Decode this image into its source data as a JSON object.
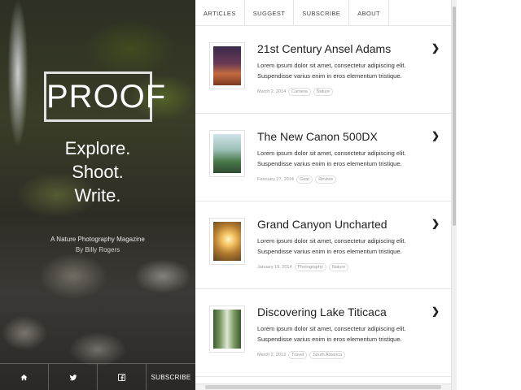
{
  "hero": {
    "logo": "PROOF",
    "tagline": [
      "Explore.",
      "Shoot.",
      "Write."
    ],
    "subtitle": "A Nature Photography Magazine",
    "byline": "By Billy Rogers"
  },
  "footer": {
    "icons": [
      "home-icon",
      "twitter-icon",
      "facebook-icon"
    ],
    "subscribe_label": "SUBSCRIBE"
  },
  "nav": [
    "ARTICLES",
    "SUGGEST",
    "SUBSCRIBE",
    "ABOUT"
  ],
  "chevron": "❯",
  "articles": [
    {
      "title": "21st Century Ansel Adams",
      "excerpt": "Lorem ipsum dolor sit amet, consectetur adipiscing elit. Suspendisse varius enim in eros elementum tristique.",
      "date": "March 2, 2014",
      "tags": [
        "Camera",
        "Nature"
      ]
    },
    {
      "title": "The New Canon 500DX",
      "excerpt": "Lorem ipsum dolor sit amet, consectetur adipiscing elit. Suspendisse varius enim in eros elementum tristique.",
      "date": "February 27, 2014",
      "tags": [
        "Gear",
        "Review"
      ]
    },
    {
      "title": "Grand Canyon Uncharted",
      "excerpt": "Lorem ipsum dolor sit amet, consectetur adipiscing elit. Suspendisse varius enim in eros elementum tristique.",
      "date": "January 19, 2014",
      "tags": [
        "Photography",
        "Nature"
      ]
    },
    {
      "title": "Discovering Lake Titicaca",
      "excerpt": "Lorem ipsum dolor sit amet, consectetur adipiscing elit. Suspendisse varius enim in eros elementum tristique.",
      "date": "March 2, 2013",
      "tags": [
        "Travel",
        "South America"
      ]
    }
  ]
}
